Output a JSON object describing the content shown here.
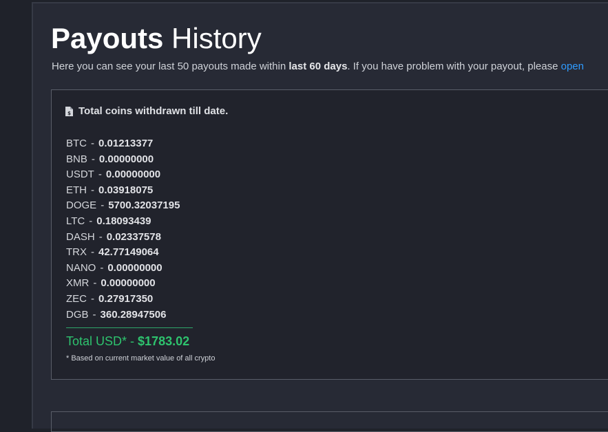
{
  "page": {
    "title_bold": "Payouts",
    "title_rest": " History",
    "intro": {
      "text1": "Here you can see your last 50 payouts made within ",
      "bold": "last 60 days",
      "text2": ". If you have problem with your payout, please ",
      "link": "open"
    }
  },
  "summary": {
    "heading": "Total coins withdrawn till date.",
    "icon": "document-icon",
    "coins": [
      {
        "symbol": "BTC",
        "amount": "0.01213377"
      },
      {
        "symbol": "BNB",
        "amount": "0.00000000"
      },
      {
        "symbol": "USDT",
        "amount": "0.00000000"
      },
      {
        "symbol": "ETH",
        "amount": "0.03918075"
      },
      {
        "symbol": "DOGE",
        "amount": "5700.32037195"
      },
      {
        "symbol": "LTC",
        "amount": "0.18093439"
      },
      {
        "symbol": "DASH",
        "amount": "0.02337578"
      },
      {
        "symbol": "TRX",
        "amount": "42.77149064"
      },
      {
        "symbol": "NANO",
        "amount": "0.00000000"
      },
      {
        "symbol": "XMR",
        "amount": "0.00000000"
      },
      {
        "symbol": "ZEC",
        "amount": "0.27917350"
      },
      {
        "symbol": "DGB",
        "amount": "360.28947506"
      }
    ],
    "separator": "-",
    "total_label": "Total USD* - ",
    "total_value": "$1783.02",
    "footnote": "* Based on current market value of all crypto"
  },
  "colors": {
    "accent_link": "#2f9bff",
    "total_green": "#2ec36e",
    "background": "#272a35"
  }
}
